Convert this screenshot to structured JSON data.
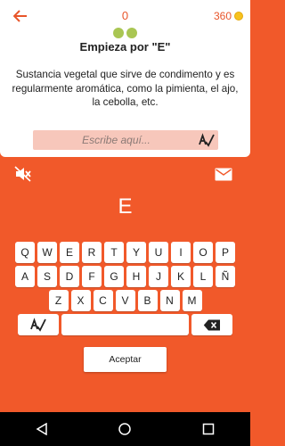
{
  "header": {
    "streak_count": "0",
    "coins": "360",
    "progress_dots": 2
  },
  "puzzle": {
    "heading": "Empieza por \"E\"",
    "clue": "Sustancia vegetal que sirve de condimento y es regularmente aromática, como la pimienta, el ajo, la cebolla, etc.",
    "answer_value": "",
    "answer_placeholder": "Escribe aquí..."
  },
  "current_letter": "E",
  "keyboard": {
    "row1": [
      "Q",
      "W",
      "E",
      "R",
      "T",
      "Y",
      "U",
      "I",
      "O",
      "P"
    ],
    "row2": [
      "A",
      "S",
      "D",
      "F",
      "G",
      "H",
      "J",
      "K",
      "L",
      "Ñ"
    ],
    "row3": [
      "Z",
      "X",
      "C",
      "V",
      "B",
      "N",
      "M"
    ]
  },
  "accept_label": "Aceptar",
  "colors": {
    "accent": "#f1592a",
    "dot_green": "#a9c653",
    "coin": "#f7c21e",
    "answer_bg": "#f7c7bb"
  }
}
